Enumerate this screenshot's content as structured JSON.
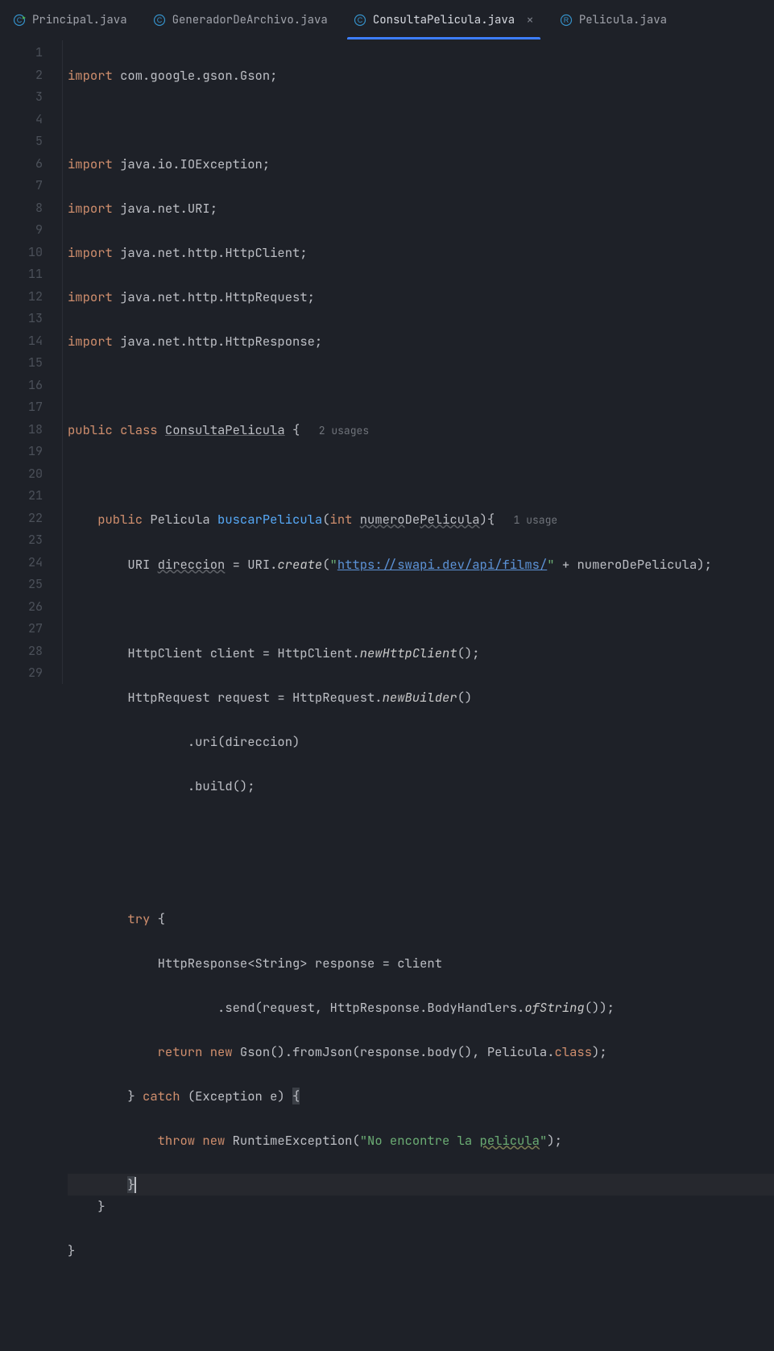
{
  "tabs": [
    {
      "label": "Principal.java",
      "icon": "class-run-icon",
      "active": false
    },
    {
      "label": "GeneradorDeArchivo.java",
      "icon": "class-icon",
      "active": false
    },
    {
      "label": "ConsultaPelicula.java",
      "icon": "class-icon",
      "active": true
    },
    {
      "label": "Pelicula.java",
      "icon": "record-icon",
      "active": false
    }
  ],
  "line_numbers": [
    "1",
    "2",
    "3",
    "4",
    "5",
    "6",
    "7",
    "8",
    "9",
    "10",
    "11",
    "12",
    "13",
    "14",
    "15",
    "16",
    "17",
    "18",
    "19",
    "20",
    "21",
    "22",
    "23",
    "24",
    "25",
    "26",
    "27",
    "28",
    "29"
  ],
  "code": {
    "l1": {
      "kw": "import",
      "rest": " com.google.gson.Gson;"
    },
    "l3": {
      "kw": "import",
      "rest": " java.io.IOException;"
    },
    "l4": {
      "kw": "import",
      "rest": " java.net.URI;"
    },
    "l5": {
      "kw": "import",
      "rest": " java.net.http.HttpClient;"
    },
    "l6": {
      "kw": "import",
      "rest": " java.net.http.HttpRequest;"
    },
    "l7": {
      "kw": "import",
      "rest": " java.net.http.HttpResponse;"
    },
    "l9": {
      "kw1": "public class ",
      "cls": "ConsultaPelicula",
      "rest": " {",
      "hint": "   2 usages"
    },
    "l11": {
      "kw1": "public",
      "sp1": " ",
      "type": "Pelicula ",
      "method": "buscarPelicula",
      "open": "(",
      "kw2": "int ",
      "p1": "numero",
      "mid": "De",
      "p2": "Pelicula",
      "close": "){",
      "hint": "   1 usage"
    },
    "l12": {
      "t1": "URI ",
      "var": "direccion",
      "t2": " = URI.",
      "m": "create",
      "t3": "(",
      "q1": "\"",
      "url": "https://swapi.dev/api/films/",
      "q2": "\"",
      "t4": " + numeroDePelicula);"
    },
    "l14": {
      "t1": "HttpClient client = HttpClient.",
      "m": "newHttpClient",
      "t2": "();"
    },
    "l15": {
      "t1": "HttpRequest request = HttpRequest.",
      "m": "newBuilder",
      "t2": "()"
    },
    "l16": {
      "t": ".uri(direccion)"
    },
    "l17": {
      "t": ".build();"
    },
    "l20": {
      "kw": "try",
      "t": " {"
    },
    "l21": {
      "t": "HttpResponse<String> response = client"
    },
    "l22": {
      "t1": ".send(request, HttpResponse.BodyHandlers.",
      "m": "ofString",
      "t2": "());"
    },
    "l23": {
      "kw1": "return new ",
      "t1": "Gson().fromJson(response.body(), Pelicula.",
      "kw2": "class",
      "t2": ");"
    },
    "l24": {
      "t1": "} ",
      "kw": "catch",
      "t2": " (Exception e) ",
      "brace": "{"
    },
    "l25": {
      "kw": "throw new ",
      "t1": "RuntimeException(",
      "str": "\"No encontre la ",
      "word": "pelicula",
      "strend": "\"",
      "t2": ");"
    },
    "l26": {
      "brace": "}"
    },
    "l27": {
      "t": "}"
    },
    "l28": {
      "t": "}"
    }
  }
}
